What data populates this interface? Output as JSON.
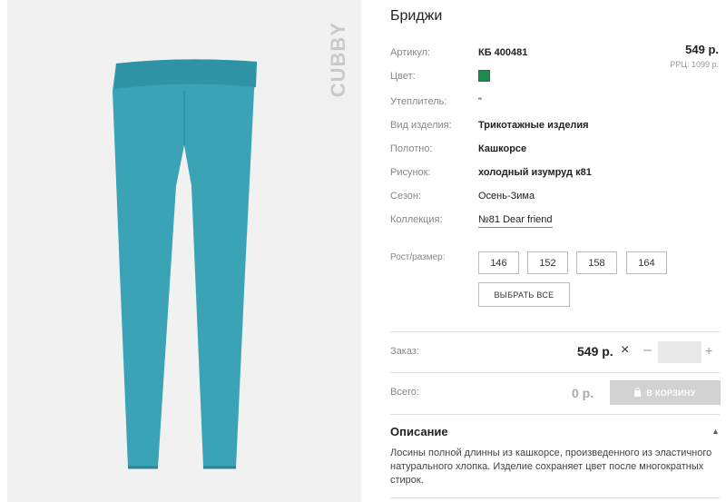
{
  "product": {
    "title": "Бриджи",
    "brand": "CUBBY",
    "price": "549 р.",
    "rrc": "РРЦ: 1099 р.",
    "color_hex": "#1e8a4c",
    "image_icon": "leggings-photo"
  },
  "specs": [
    {
      "label": "Артикул:",
      "value": "КБ 400481"
    },
    {
      "label": "Цвет:",
      "value": ""
    },
    {
      "label": "Утеплитель:",
      "value": "\""
    },
    {
      "label": "Вид изделия:",
      "value": "Трикотажные изделия"
    },
    {
      "label": "Полотно:",
      "value": "Кашкорсе"
    },
    {
      "label": "Рисунок:",
      "value": "холодный изумруд к81"
    },
    {
      "label": "Сезон:",
      "value": "Осень-Зима"
    },
    {
      "label": "Коллекция:",
      "value": "№81 Dear friend"
    }
  ],
  "sizes": {
    "label": "Рост/размер:",
    "options": [
      "146",
      "152",
      "158",
      "164"
    ],
    "select_all": "ВЫБРАТЬ ВСЕ"
  },
  "order": {
    "label": "Заказ:",
    "price": "549 р.",
    "times": "×",
    "minus": "–",
    "plus": "+",
    "quantity": ""
  },
  "total": {
    "label": "Всего:",
    "value": "0 р.",
    "cart_button": "В КОРЗИНУ"
  },
  "description": {
    "title": "Описание",
    "text": "Лосины полной длинны из кашкорсе, произведенного из эластичного натурального хлопка. Изделие сохраняет цвет после многократных стирок."
  }
}
